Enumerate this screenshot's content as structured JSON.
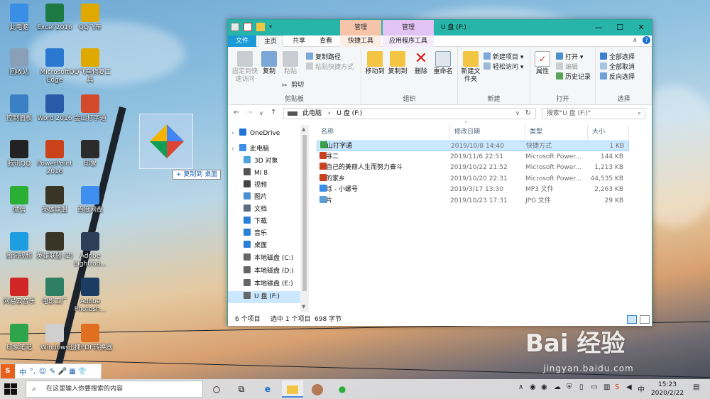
{
  "desktop": {
    "icons": [
      {
        "label": "此电脑",
        "color": "#3a8ee6"
      },
      {
        "label": "Excel 2016",
        "color": "#1d7a43"
      },
      {
        "label": "QQ飞车",
        "color": "#e0a900"
      },
      {
        "label": "回收站",
        "color": "#8aa0b8"
      },
      {
        "label": "Microsoft Edge",
        "color": "#2b78d0"
      },
      {
        "label": "QQ飞车修复工具",
        "color": "#e0a900"
      },
      {
        "label": "控制面板",
        "color": "#3b7fc4"
      },
      {
        "label": "Word 2016",
        "color": "#2a5ba8"
      },
      {
        "label": "金山打字通",
        "color": "#d34a2a"
      },
      {
        "label": "腾讯QQ",
        "color": "#222222"
      },
      {
        "label": "PowerPoint 2016",
        "color": "#c9421b"
      },
      {
        "label": "印象",
        "color": "#2b2b2b"
      },
      {
        "label": "微信",
        "color": "#2aae34"
      },
      {
        "label": "英雄联盟",
        "color": "#3a3426"
      },
      {
        "label": "百度网盘",
        "color": "#3f8ff0"
      },
      {
        "label": "腾讯视频",
        "color": "#1e9de0"
      },
      {
        "label": "英雄联盟 (2)",
        "color": "#3a3426"
      },
      {
        "label": "Adobe Lightroo...",
        "color": "#2c3e58"
      },
      {
        "label": "网易云音乐",
        "color": "#d02626"
      },
      {
        "label": "电影工厂",
        "color": "#2f7f64"
      },
      {
        "label": "Adobe Photosh...",
        "color": "#1b3d64"
      },
      {
        "label": "印象笔记",
        "color": "#2ea54d"
      },
      {
        "label": "Windows",
        "color": "#cfcfcf"
      },
      {
        "label": "迅捷PDF转换器",
        "color": "#e07020"
      }
    ],
    "drag_tooltip": "+ 复制到 桌面",
    "watermark": "Bai 经验",
    "watermark_sub": "jingyan.baidu.com"
  },
  "window": {
    "title": "U 盘 (F:)",
    "ctx_tab_1": "管理",
    "ctx_tab_2": "管理",
    "ctx_color_1": "#f6c4a8",
    "ctx_color_2": "#e3c3f4",
    "minimize": "—",
    "maximize": "☐",
    "close": "✕",
    "tabs": [
      "文件",
      "主页",
      "共享",
      "查看",
      "快捷工具",
      "应用程序工具"
    ],
    "ribbon": {
      "clipboard": {
        "label": "剪贴板",
        "pin": "固定到快速访问",
        "copy": "复制",
        "paste": "粘贴",
        "copy_path": "复制路径",
        "paste_shortcut": "粘贴快捷方式",
        "cut": "剪切"
      },
      "organize": {
        "label": "组织",
        "move_to": "移动到",
        "copy_to": "复制到",
        "delete": "删除",
        "rename": "重命名"
      },
      "new": {
        "label": "新建",
        "new_folder": "新建文件夹",
        "new_item": "新建项目",
        "easy_access": "轻松访问"
      },
      "open": {
        "label": "打开",
        "properties": "属性",
        "open": "打开",
        "edit": "编辑",
        "history": "历史记录"
      },
      "select": {
        "label": "选择",
        "select_all": "全部选择",
        "select_none": "全部取消",
        "invert": "反向选择"
      }
    },
    "address": {
      "path_root": "此电脑",
      "path_sep": "›",
      "path_current": "U 盘 (F:)",
      "search_placeholder": "搜索\"U 盘 (F:)\""
    },
    "nav": [
      {
        "label": "OneDrive",
        "color": "#1f76d3"
      },
      {
        "label": "此电脑",
        "color": "#3a8ee6"
      },
      {
        "label": "3D 对象",
        "color": "#4aa3d9"
      },
      {
        "label": "MI 8",
        "color": "#555555"
      },
      {
        "label": "视频",
        "color": "#444444"
      },
      {
        "label": "图片",
        "color": "#4a8fd0"
      },
      {
        "label": "文档",
        "color": "#5a6f85"
      },
      {
        "label": "下载",
        "color": "#2a7fd6"
      },
      {
        "label": "音乐",
        "color": "#2a7fd6"
      },
      {
        "label": "桌面",
        "color": "#2a7fd6"
      },
      {
        "label": "本地磁盘 (C:)",
        "color": "#666666"
      },
      {
        "label": "本地磁盘 (D:)",
        "color": "#666666"
      },
      {
        "label": "本地磁盘 (E:)",
        "color": "#666666"
      },
      {
        "label": "U 盘 (F:)",
        "color": "#666666"
      }
    ],
    "columns": [
      "名称",
      "修改日期",
      "类型",
      "大小"
    ],
    "files": [
      {
        "name": "金山打字通",
        "date": "2019/10/8 14:40",
        "type": "快捷方式",
        "size": "1 KB",
        "icon_color": "#3aa04a"
      },
      {
        "name": "探寻二",
        "date": "2019/11/6 22:51",
        "type": "Microsoft Power...",
        "size": "144 KB",
        "icon_color": "#c9421b"
      },
      {
        "name": "为自己的美丽人生而努力奋斗",
        "date": "2019/10/22 21:52",
        "type": "Microsoft Power...",
        "size": "1,213 KB",
        "icon_color": "#c9421b"
      },
      {
        "name": "我的家乡",
        "date": "2019/10/20 22:31",
        "type": "Microsoft Power...",
        "size": "44,535 KB",
        "icon_color": "#c9421b"
      },
      {
        "name": "杨烁 - 小螺号",
        "date": "2019/3/17 13:30",
        "type": "MP3 文件",
        "size": "2,263 KB",
        "icon_color": "#3a8ee6"
      },
      {
        "name": "照片",
        "date": "2019/10/23 17:31",
        "type": "JPG 文件",
        "size": "29 KB",
        "icon_color": "#5a9fd8"
      }
    ],
    "status": {
      "count": "6 个项目",
      "selected": "选中 1 个项目",
      "size": "698 字节"
    }
  },
  "ime": [
    "S",
    "中",
    "°,",
    "☺",
    "✎",
    "🎤",
    "▦",
    "👕"
  ],
  "taskbar": {
    "search_placeholder": "在这里输入你要搜索的内容",
    "time": "15:23",
    "date": "2020/2/22"
  }
}
